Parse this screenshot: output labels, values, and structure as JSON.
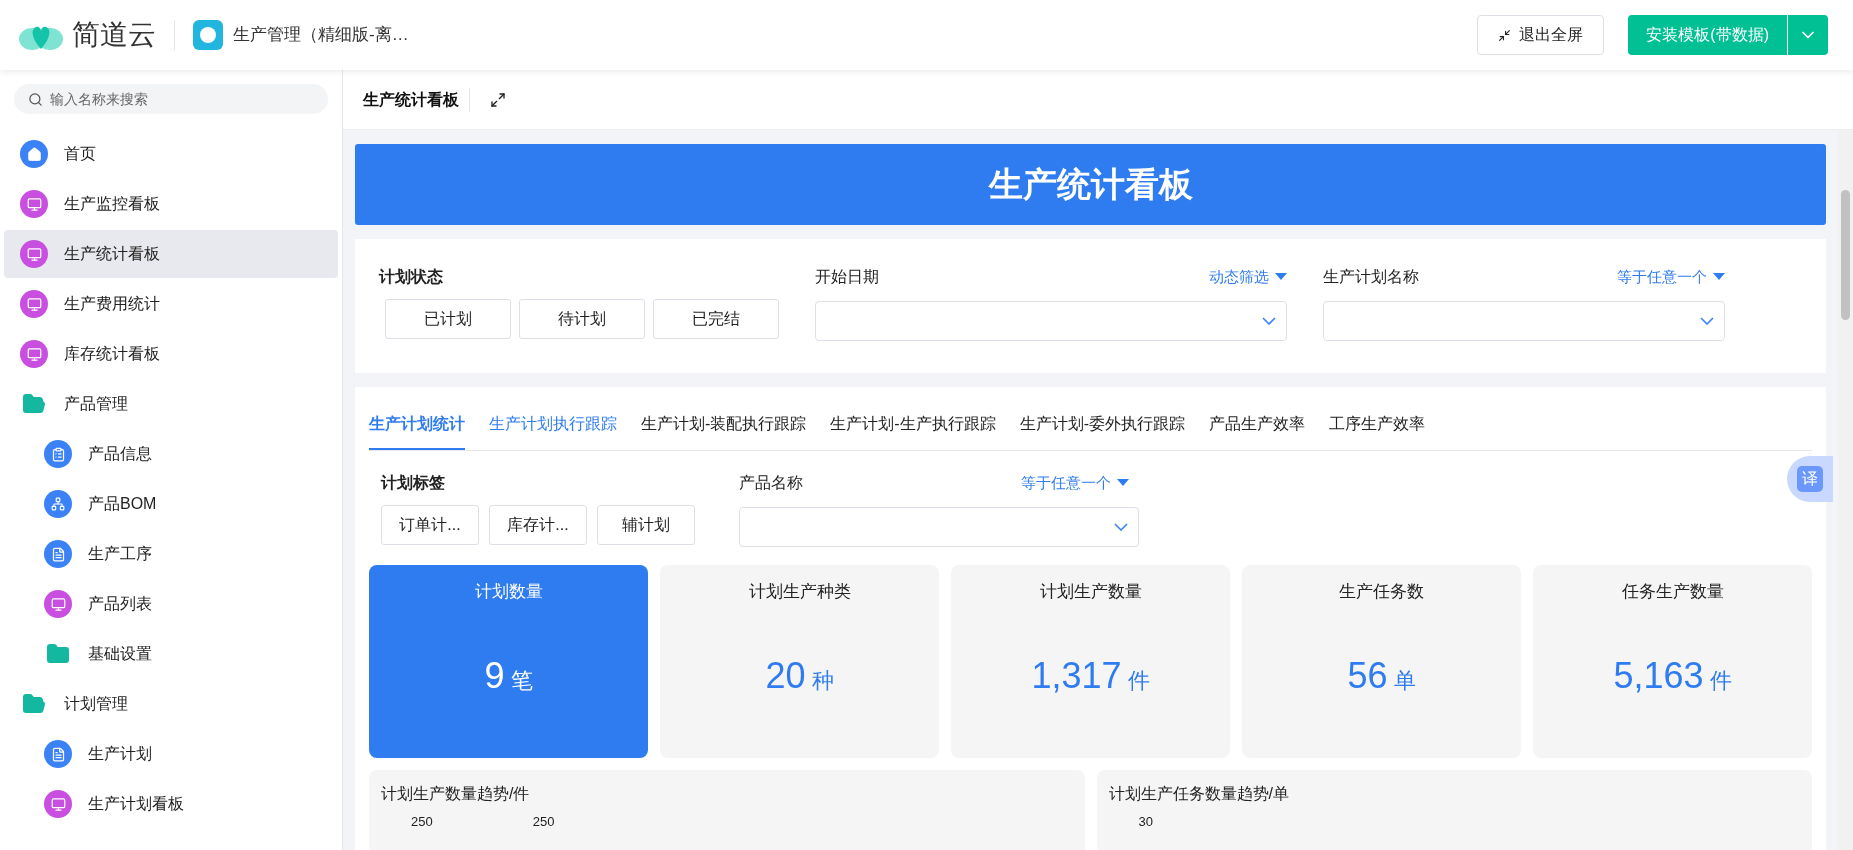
{
  "header": {
    "brand": "简道云",
    "app_title": "生产管理（精细版-离…",
    "exit_button": "退出全屏",
    "install_button": "安装模板(带数据)"
  },
  "sidebar": {
    "search": {
      "placeholder": "输入名称来搜索"
    },
    "items": [
      {
        "label": "首页",
        "kind": "home",
        "selected": false
      },
      {
        "label": "生产监控看板",
        "kind": "dashboard",
        "selected": false
      },
      {
        "label": "生产统计看板",
        "kind": "dashboard",
        "selected": true
      },
      {
        "label": "生产费用统计",
        "kind": "dashboard",
        "selected": false
      },
      {
        "label": "库存统计看板",
        "kind": "dashboard",
        "selected": false
      },
      {
        "label": "产品管理",
        "kind": "folder",
        "selected": false,
        "expanded": true,
        "children": [
          {
            "label": "产品信息",
            "kind": "form",
            "selected": false
          },
          {
            "label": "产品BOM",
            "kind": "bom",
            "selected": false
          },
          {
            "label": "生产工序",
            "kind": "doc",
            "selected": false
          },
          {
            "label": "产品列表",
            "kind": "dashboard",
            "selected": false
          },
          {
            "label": "基础设置",
            "kind": "folder",
            "selected": false,
            "expanded": false
          }
        ]
      },
      {
        "label": "计划管理",
        "kind": "folder",
        "selected": false,
        "expanded": true,
        "children": [
          {
            "label": "生产计划",
            "kind": "doc",
            "selected": false
          },
          {
            "label": "生产计划看板",
            "kind": "dashboard",
            "selected": false
          }
        ]
      }
    ]
  },
  "page": {
    "title": "生产统计看板",
    "banner": "生产统计看板"
  },
  "filters": {
    "status": {
      "label": "计划状态",
      "options": [
        "已计划",
        "待计划",
        "已完结"
      ]
    },
    "start_date": {
      "label": "开始日期",
      "mode": "动态筛选"
    },
    "plan_name": {
      "label": "生产计划名称",
      "mode": "等于任意一个"
    }
  },
  "tabs": [
    {
      "label": "生产计划统计",
      "selected": true,
      "highlighted": false
    },
    {
      "label": "生产计划执行跟踪",
      "selected": false,
      "highlighted": true
    },
    {
      "label": "生产计划-装配执行跟踪",
      "selected": false,
      "highlighted": false
    },
    {
      "label": "生产计划-生产执行跟踪",
      "selected": false,
      "highlighted": false
    },
    {
      "label": "生产计划-委外执行跟踪",
      "selected": false,
      "highlighted": false
    },
    {
      "label": "产品生产效率",
      "selected": false,
      "highlighted": false
    },
    {
      "label": "工序生产效率",
      "selected": false,
      "highlighted": false
    }
  ],
  "tab_filters": {
    "tag": {
      "label": "计划标签",
      "options": [
        "订单计...",
        "库存计...",
        "辅计划"
      ]
    },
    "product": {
      "label": "产品名称",
      "mode": "等于任意一个"
    }
  },
  "kpis": [
    {
      "title": "计划数量",
      "value": "9",
      "unit": "笔",
      "selected": true
    },
    {
      "title": "计划生产种类",
      "value": "20",
      "unit": "种",
      "selected": false
    },
    {
      "title": "计划生产数量",
      "value": "1,317",
      "unit": "件",
      "selected": false
    },
    {
      "title": "生产任务数",
      "value": "56",
      "unit": "单",
      "selected": false
    },
    {
      "title": "任务生产数量",
      "value": "5,163",
      "unit": "件",
      "selected": false
    }
  ],
  "charts": [
    {
      "title": "计划生产数量趋势/件",
      "texts": [
        "250",
        "250"
      ]
    },
    {
      "title": "计划生产任务数量趋势/单",
      "texts": [
        "30"
      ]
    }
  ],
  "translate_button": "译"
}
